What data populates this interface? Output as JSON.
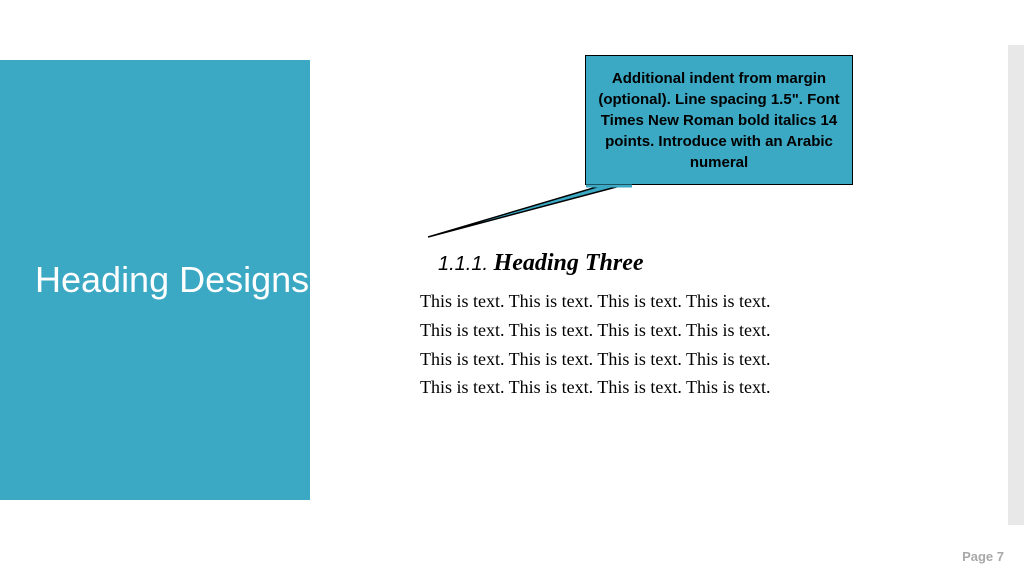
{
  "sidebar": {
    "title": "Heading Designs"
  },
  "callout": {
    "text": "Additional  indent from margin (optional). Line spacing 1.5\". Font Times New Roman bold italics 14 points. Introduce with an Arabic numeral"
  },
  "content": {
    "heading_number": "1.1.1.",
    "heading_title": "Heading Three",
    "body_lines": [
      "This is text. This is text. This is text. This is text.",
      "This is text. This is text. This is text. This is text.",
      "This is text. This is text. This is text. This is text.",
      "This is text. This is text. This is text. This is text."
    ]
  },
  "footer": {
    "page_label": "Page",
    "page_number": "7"
  },
  "colors": {
    "accent": "#3ba8c4"
  }
}
